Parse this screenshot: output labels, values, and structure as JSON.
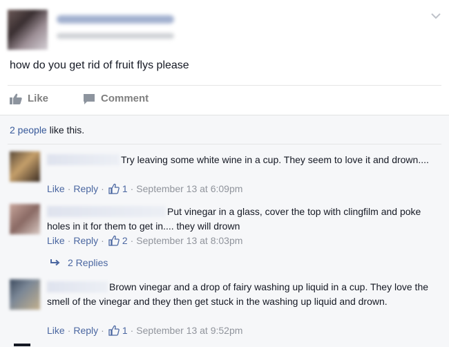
{
  "post": {
    "text": "how do you get rid of fruit flys please"
  },
  "actions": {
    "like_label": "Like",
    "comment_label": "Comment"
  },
  "likes_summary": {
    "count_text": "2 people",
    "suffix": " like this."
  },
  "comments": [
    {
      "text": "Try leaving some white wine in a cup. They seem to love it and drown....",
      "like_label": "Like",
      "reply_label": "Reply",
      "likes": "1",
      "time": "September 13 at 6:09pm"
    },
    {
      "text": "Put vinegar in a glass, cover the top with clingfilm and poke holes in it for them to get in.... they will drown",
      "like_label": "Like",
      "reply_label": "Reply",
      "likes": "2",
      "time": "September 13 at 8:03pm"
    },
    {
      "text": "Brown vinegar and a drop of fairy washing up liquid in a cup. They love the smell of the vinegar and they then get stuck in the washing up liquid and drown.",
      "like_label": "Like",
      "reply_label": "Reply",
      "likes": "1",
      "time": "September 13 at 9:52pm"
    }
  ],
  "replies_link": "2 Replies",
  "separator": "·",
  "colors": {
    "link": "#365899",
    "meta": "#90949c",
    "panel": "#f6f7f9"
  },
  "icons": {
    "chevron": "chevron-down-icon",
    "like": "thumbs-up-icon",
    "comment": "comment-bubble-icon",
    "reply_arrow": "reply-arrow-icon"
  }
}
